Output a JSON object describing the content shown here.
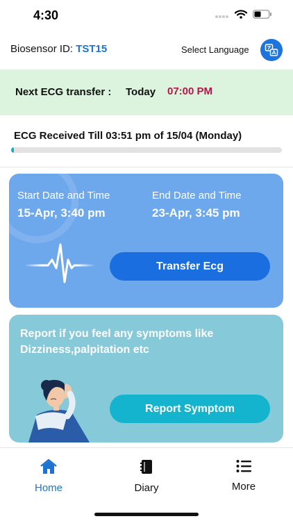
{
  "status_bar": {
    "time": "4:30",
    "battery_level": 0.45
  },
  "header": {
    "biosensor_label": "Biosensor ID:",
    "biosensor_id": "TST15",
    "language_label": "Select Language",
    "language_icon": "language-translate-icon"
  },
  "next_transfer": {
    "label": "Next ECG transfer :",
    "day": "Today",
    "time": "07:00 PM",
    "time_color": "#b3164b"
  },
  "received": {
    "text": "ECG Received Till 03:51 pm of 15/04 (Monday)",
    "progress": 0.01
  },
  "ecg_card": {
    "start_label": "Start Date and Time",
    "start_value": "15-Apr, 3:40 pm",
    "end_label": "End Date and Time",
    "end_value": "23-Apr, 3:45 pm",
    "button_label": "Transfer Ecg",
    "icon": "ecg-wave-icon",
    "color": "#6ea8ec"
  },
  "report_card": {
    "text": "Report if you feel any symptoms like Dizziness,palpitation etc",
    "button_label": "Report Symptom",
    "illustration": "woman-headache-illustration",
    "color": "#86c9d9"
  },
  "tabbar": {
    "tabs": [
      {
        "label": "Home",
        "icon": "home-icon",
        "active": true
      },
      {
        "label": "Diary",
        "icon": "diary-icon",
        "active": false
      },
      {
        "label": "More",
        "icon": "menu-list-icon",
        "active": false
      }
    ],
    "active_color": "#1c73d0"
  }
}
